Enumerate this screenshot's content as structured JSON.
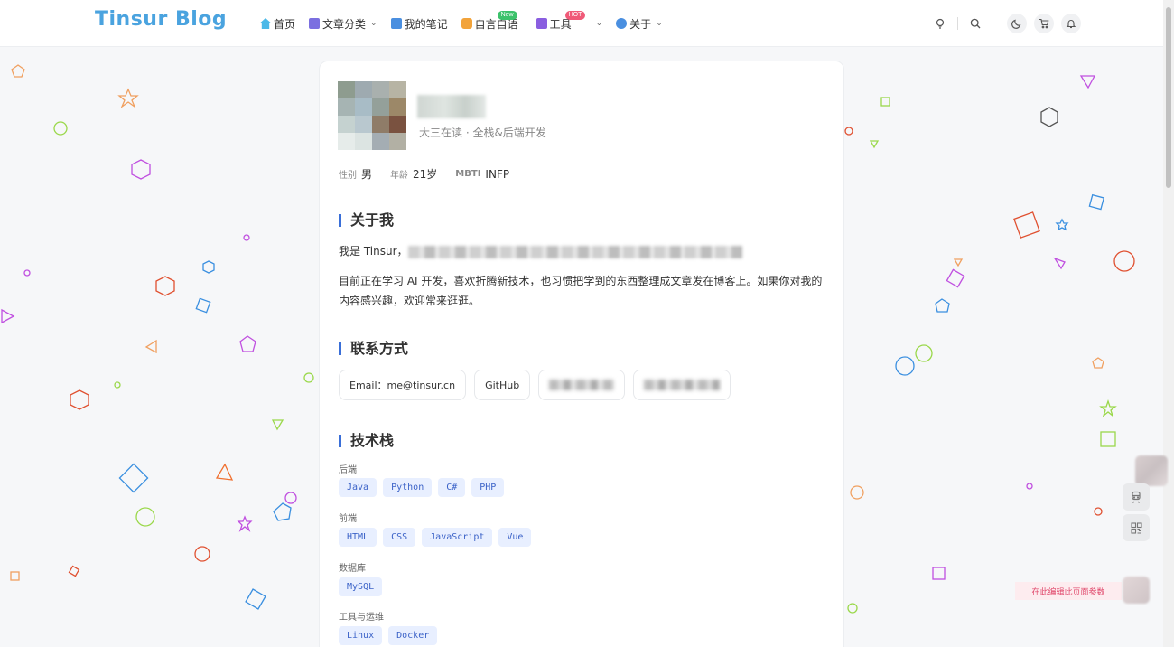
{
  "colors": {
    "logo": "#4aa3df",
    "accent": "#3a6fd8",
    "tag_bg": "#e8efff",
    "tag_text": "#3c63c8",
    "badge_new": "#3cc26b",
    "badge_hot": "#f05a78"
  },
  "header": {
    "logo": "Tinsur Blog",
    "nav": [
      {
        "label": "首页",
        "icon": "home-icon",
        "has_menu": false
      },
      {
        "label": "文章分类",
        "icon": "book-icon",
        "has_menu": true
      },
      {
        "label": "我的笔记",
        "icon": "notebook-icon",
        "has_menu": false
      },
      {
        "label": "自言自语",
        "icon": "chat-icon",
        "has_menu": false,
        "badge": "New"
      },
      {
        "label": "工具",
        "icon": "tools-icon",
        "has_menu": true,
        "badge": "HOT"
      },
      {
        "label": "关于",
        "icon": "user-icon",
        "has_menu": true
      }
    ],
    "actions": [
      "bulb-icon",
      "search-icon",
      "moon-icon",
      "cart-icon",
      "bell-icon"
    ]
  },
  "profile": {
    "subtitle": "大三在读 · 全栈&后端开发",
    "meta": [
      {
        "key": "性别",
        "value": "男"
      },
      {
        "key": "年龄",
        "value": "21岁"
      },
      {
        "key": "MBTI",
        "value": "INFP"
      }
    ]
  },
  "about": {
    "title": "关于我",
    "intro": "我是 Tinsur，",
    "body": "目前正在学习 AI 开发，喜欢折腾新技术，也习惯把学到的东西整理成文章发在博客上。如果你对我的内容感兴趣，欢迎常来逛逛。"
  },
  "contact": {
    "title": "联系方式",
    "items": [
      "Email：me@tinsur.cn",
      "GitHub"
    ]
  },
  "tech": {
    "title": "技术栈",
    "groups": [
      {
        "name": "后端",
        "tags": [
          "Java",
          "Python",
          "C#",
          "PHP"
        ]
      },
      {
        "name": "前端",
        "tags": [
          "HTML",
          "CSS",
          "JavaScript",
          "Vue"
        ]
      },
      {
        "name": "数据库",
        "tags": [
          "MySQL"
        ]
      },
      {
        "name": "工具与运维",
        "tags": [
          "Linux",
          "Docker"
        ]
      }
    ]
  },
  "widgets": {
    "edit_label": "在此编辑此页面参数",
    "icons": [
      "train-icon",
      "qrcode-icon"
    ]
  }
}
